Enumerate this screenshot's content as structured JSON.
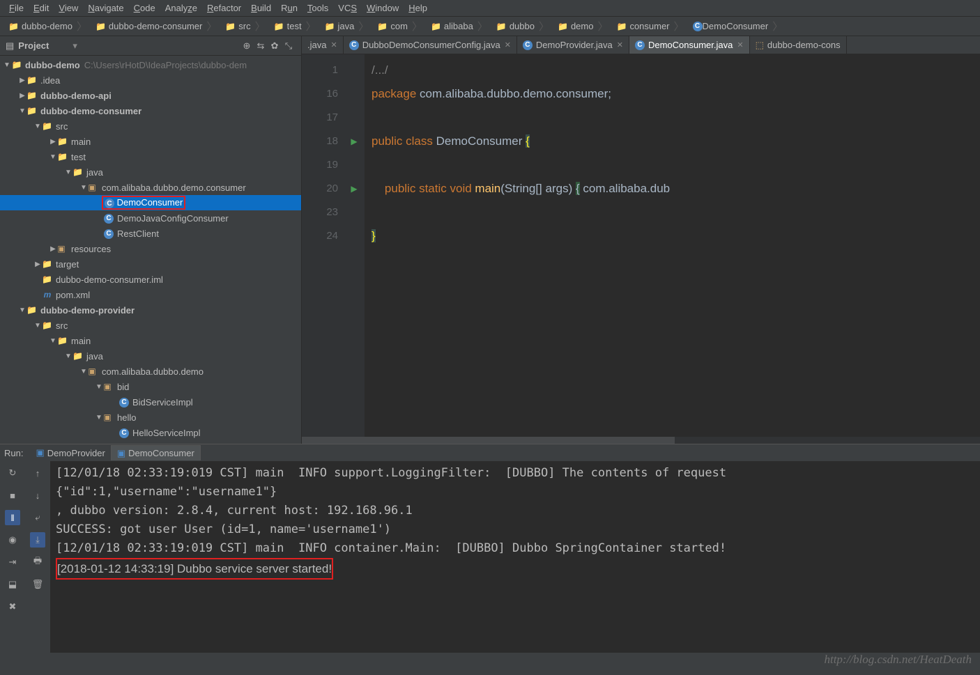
{
  "menu": [
    "File",
    "Edit",
    "View",
    "Navigate",
    "Code",
    "Analyze",
    "Refactor",
    "Build",
    "Run",
    "Tools",
    "VCS",
    "Window",
    "Help"
  ],
  "breadcrumbs": [
    {
      "icon": "📁",
      "label": "dubbo-demo"
    },
    {
      "icon": "📁",
      "label": "dubbo-demo-consumer"
    },
    {
      "icon": "📁",
      "label": "src"
    },
    {
      "icon": "📁",
      "label": "test"
    },
    {
      "icon": "📁",
      "label": "java"
    },
    {
      "icon": "📁",
      "label": "com"
    },
    {
      "icon": "📁",
      "label": "alibaba"
    },
    {
      "icon": "📁",
      "label": "dubbo"
    },
    {
      "icon": "📁",
      "label": "demo"
    },
    {
      "icon": "📁",
      "label": "consumer"
    },
    {
      "icon": "C",
      "label": "DemoConsumer"
    }
  ],
  "panel": {
    "title": "Project",
    "dropdown": "▾"
  },
  "tree": {
    "root": {
      "label": "dubbo-demo",
      "path": "C:\\Users\\rHotD\\IdeaProjects\\dubbo-dem"
    },
    "items": [
      {
        "indent": 1,
        "arrow": "▶",
        "icon": "📁",
        "label": ".idea"
      },
      {
        "indent": 1,
        "arrow": "▶",
        "icon": "📁",
        "label": "dubbo-demo-api",
        "bold": true
      },
      {
        "indent": 1,
        "arrow": "▼",
        "icon": "📁",
        "label": "dubbo-demo-consumer",
        "bold": true
      },
      {
        "indent": 2,
        "arrow": "▼",
        "icon": "📁",
        "label": "src"
      },
      {
        "indent": 3,
        "arrow": "▶",
        "icon": "📁",
        "label": "main"
      },
      {
        "indent": 3,
        "arrow": "▼",
        "icon": "📁",
        "label": "test"
      },
      {
        "indent": 4,
        "arrow": "▼",
        "icon": "📁",
        "label": "java",
        "green": true
      },
      {
        "indent": 5,
        "arrow": "▼",
        "icon": "📦",
        "label": "com.alibaba.dubbo.demo.consumer"
      },
      {
        "indent": 6,
        "arrow": "",
        "icon": "C",
        "label": "DemoConsumer",
        "selected": true,
        "boxed": true
      },
      {
        "indent": 6,
        "arrow": "",
        "icon": "C",
        "label": "DemoJavaConfigConsumer"
      },
      {
        "indent": 6,
        "arrow": "",
        "icon": "C",
        "label": "RestClient"
      },
      {
        "indent": 3,
        "arrow": "▶",
        "icon": "📦",
        "label": "resources"
      },
      {
        "indent": 2,
        "arrow": "▶",
        "icon": "📁",
        "label": "target",
        "orange": true
      },
      {
        "indent": 2,
        "arrow": "",
        "icon": "📄",
        "label": "dubbo-demo-consumer.iml"
      },
      {
        "indent": 2,
        "arrow": "",
        "icon": "m",
        "label": "pom.xml"
      },
      {
        "indent": 1,
        "arrow": "▼",
        "icon": "📁",
        "label": "dubbo-demo-provider",
        "bold": true
      },
      {
        "indent": 2,
        "arrow": "▼",
        "icon": "📁",
        "label": "src"
      },
      {
        "indent": 3,
        "arrow": "▼",
        "icon": "📁",
        "label": "main"
      },
      {
        "indent": 4,
        "arrow": "▼",
        "icon": "📁",
        "label": "java"
      },
      {
        "indent": 5,
        "arrow": "▼",
        "icon": "📦",
        "label": "com.alibaba.dubbo.demo"
      },
      {
        "indent": 6,
        "arrow": "▼",
        "icon": "📦",
        "label": "bid"
      },
      {
        "indent": 7,
        "arrow": "",
        "icon": "C",
        "label": "BidServiceImpl"
      },
      {
        "indent": 6,
        "arrow": "▼",
        "icon": "📦",
        "label": "hello"
      },
      {
        "indent": 7,
        "arrow": "",
        "icon": "C",
        "label": "HelloServiceImpl"
      }
    ]
  },
  "tabs": [
    {
      "label": ".java",
      "icon": "",
      "active": false,
      "close": true
    },
    {
      "label": "DubboDemoConsumerConfig.java",
      "icon": "C",
      "active": false,
      "close": true
    },
    {
      "label": "DemoProvider.java",
      "icon": "C",
      "active": false,
      "close": true
    },
    {
      "label": "DemoConsumer.java",
      "icon": "C",
      "active": true,
      "close": true
    },
    {
      "label": "dubbo-demo-cons",
      "icon": "⬚",
      "active": false,
      "close": false
    }
  ],
  "code": {
    "lines": [
      {
        "n": "1",
        "html": "<span class='cm'>/.../</span>"
      },
      {
        "n": "16",
        "html": "<span class='kw'>package</span> <span class='pkg'>com.alibaba.dubbo.demo.consumer</span>;"
      },
      {
        "n": "17",
        "html": ""
      },
      {
        "n": "18",
        "run": true,
        "html": "<span class='kw'>public</span> <span class='kw'>class</span> DemoConsumer <span class='brh'>{</span>"
      },
      {
        "n": "19",
        "html": ""
      },
      {
        "n": "20",
        "run": true,
        "html": "    <span class='kw'>public</span> <span class='kw'>static</span> <span class='kw'>void</span> <span class='fn'>main</span>(String[] args) <span style='background:#32593d'>{</span> com.alibaba.dub"
      },
      {
        "n": "23",
        "html": ""
      },
      {
        "n": "24",
        "html": "<span class='brh'>}</span>"
      }
    ]
  },
  "run": {
    "label": "Run:",
    "tabs": [
      {
        "label": "DemoProvider",
        "active": false
      },
      {
        "label": "DemoConsumer",
        "active": true
      }
    ],
    "console": [
      "[12/01/18 02:33:19:019 CST] main  INFO support.LoggingFilter:  [DUBBO] The contents of request",
      "{\"id\":1,\"username\":\"username1\"}",
      ", dubbo version: 2.8.4, current host: 192.168.96.1",
      "SUCCESS: got user User (id=1, name='username1')",
      "[12/01/18 02:33:19:019 CST] main  INFO container.Main:  [DUBBO] Dubbo SpringContainer started!",
      "[2018-01-12 14:33:19] Dubbo service server started!"
    ]
  },
  "watermark": "http://blog.csdn.net/HeatDeath"
}
